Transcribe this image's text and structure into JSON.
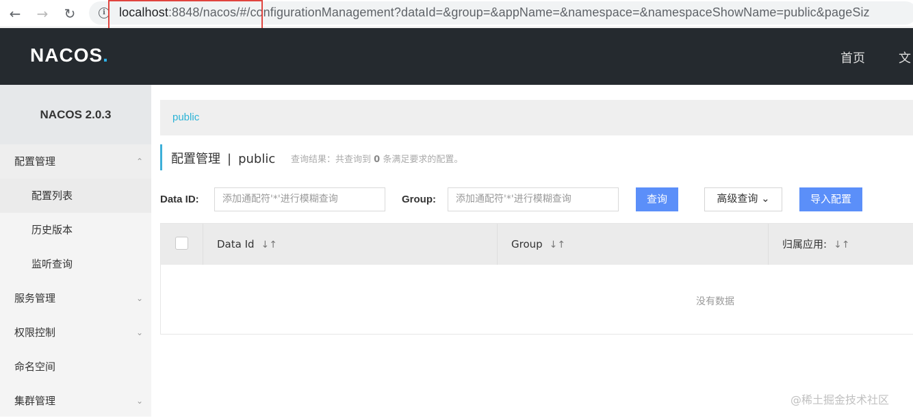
{
  "browser": {
    "url_host": "localhost",
    "url_rest": ":8848/nacos/#/configurationManagement?dataId=&group=&appName=&namespace=&namespaceShowName=public&pageSiz"
  },
  "header": {
    "logo_prefix": "NA",
    "logo_o": "C",
    "logo_suffix": "OS",
    "logo_dot": ".",
    "nav": [
      "首页",
      "文"
    ]
  },
  "sidebar": {
    "title": "NACOS 2.0.3",
    "items": [
      {
        "label": "配置管理",
        "type": "group",
        "chevron": "chevron-up-icon"
      },
      {
        "label": "配置列表",
        "type": "sub",
        "active": true
      },
      {
        "label": "历史版本",
        "type": "sub"
      },
      {
        "label": "监听查询",
        "type": "sub"
      },
      {
        "label": "服务管理",
        "type": "top",
        "chevron": "chevron-down-icon"
      },
      {
        "label": "权限控制",
        "type": "top",
        "chevron": "chevron-down-icon"
      },
      {
        "label": "命名空间",
        "type": "top"
      },
      {
        "label": "集群管理",
        "type": "top",
        "chevron": "chevron-down-icon"
      }
    ]
  },
  "breadcrumb": "public",
  "page": {
    "title": "配置管理",
    "separator": "|",
    "namespace": "public",
    "result_prefix": "查询结果：共查询到",
    "result_count": "0",
    "result_suffix": "条满足要求的配置。"
  },
  "search": {
    "dataid_label": "Data ID:",
    "dataid_placeholder": "添加通配符'*'进行模糊查询",
    "group_label": "Group:",
    "group_placeholder": "添加通配符'*'进行模糊查询",
    "query_button": "查询",
    "advanced_button": "高级查询",
    "import_button": "导入配置"
  },
  "table": {
    "columns": [
      "Data Id",
      "Group",
      "归属应用:"
    ],
    "empty_text": "没有数据"
  },
  "watermark": "@稀土掘金技术社区",
  "colors": {
    "header_bg": "#252a2f",
    "primary": "#5b8ff9",
    "accent": "#3dafd8",
    "highlight_box": "#e0443e"
  }
}
